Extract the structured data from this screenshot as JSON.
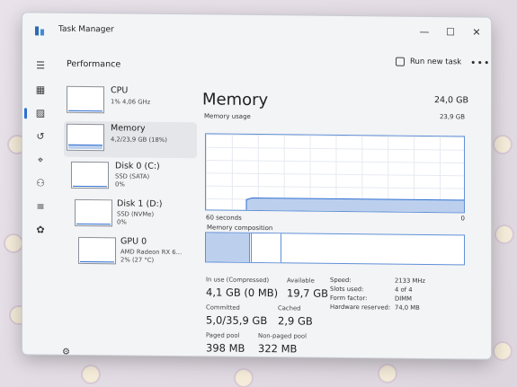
{
  "window": {
    "title": "Task Manager",
    "minimize": "—",
    "maximize": "☐",
    "close": "✕"
  },
  "header": {
    "title": "Performance",
    "run_new_task": "Run new task",
    "more": "•••"
  },
  "sidebar_icons": [
    "hamburger-icon",
    "processes-icon",
    "performance-icon",
    "history-icon",
    "startup-icon",
    "users-icon",
    "details-icon",
    "services-icon"
  ],
  "devices": [
    {
      "name": "CPU",
      "line1": "1% 4,06 GHz",
      "line2": "",
      "usage_fraction": 0.01
    },
    {
      "name": "Memory",
      "line1": "4,2/23,9 GB (18%)",
      "line2": "",
      "usage_fraction": 0.18
    },
    {
      "name": "Disk 0 (C:)",
      "line1": "SSD (SATA)",
      "line2": "0%",
      "usage_fraction": 0.0
    },
    {
      "name": "Disk 1 (D:)",
      "line1": "SSD (NVMe)",
      "line2": "0%",
      "usage_fraction": 0.0
    },
    {
      "name": "GPU 0",
      "line1": "AMD Radeon RX 6...",
      "line2": "2% (27 °C)",
      "usage_fraction": 0.02
    }
  ],
  "main": {
    "title": "Memory",
    "total": "24,0 GB",
    "usage_label": "Memory usage",
    "usage_max": "23,9 GB",
    "time_label": "60 seconds",
    "zero_label": "0",
    "composition_label": "Memory composition",
    "usage_fraction": 0.18
  },
  "stats": {
    "in_use_label": "In use (Compressed)",
    "in_use": "4,1 GB (0 MB)",
    "available_label": "Available",
    "available": "19,7 GB",
    "committed_label": "Committed",
    "committed": "5,0/35,9 GB",
    "cached_label": "Cached",
    "cached": "2,9 GB",
    "paged_label": "Paged pool",
    "paged": "398 MB",
    "nonpaged_label": "Non-paged pool",
    "nonpaged": "322 MB"
  },
  "details": [
    {
      "key": "Speed:",
      "value": "2133 MHz"
    },
    {
      "key": "Slots used:",
      "value": "4 of 4"
    },
    {
      "key": "Form factor:",
      "value": "DIMM"
    },
    {
      "key": "Hardware reserved:",
      "value": "74,0 MB"
    }
  ],
  "colors": {
    "accent": "#2f6fd0",
    "memory_fill": "#bcd0ee"
  }
}
